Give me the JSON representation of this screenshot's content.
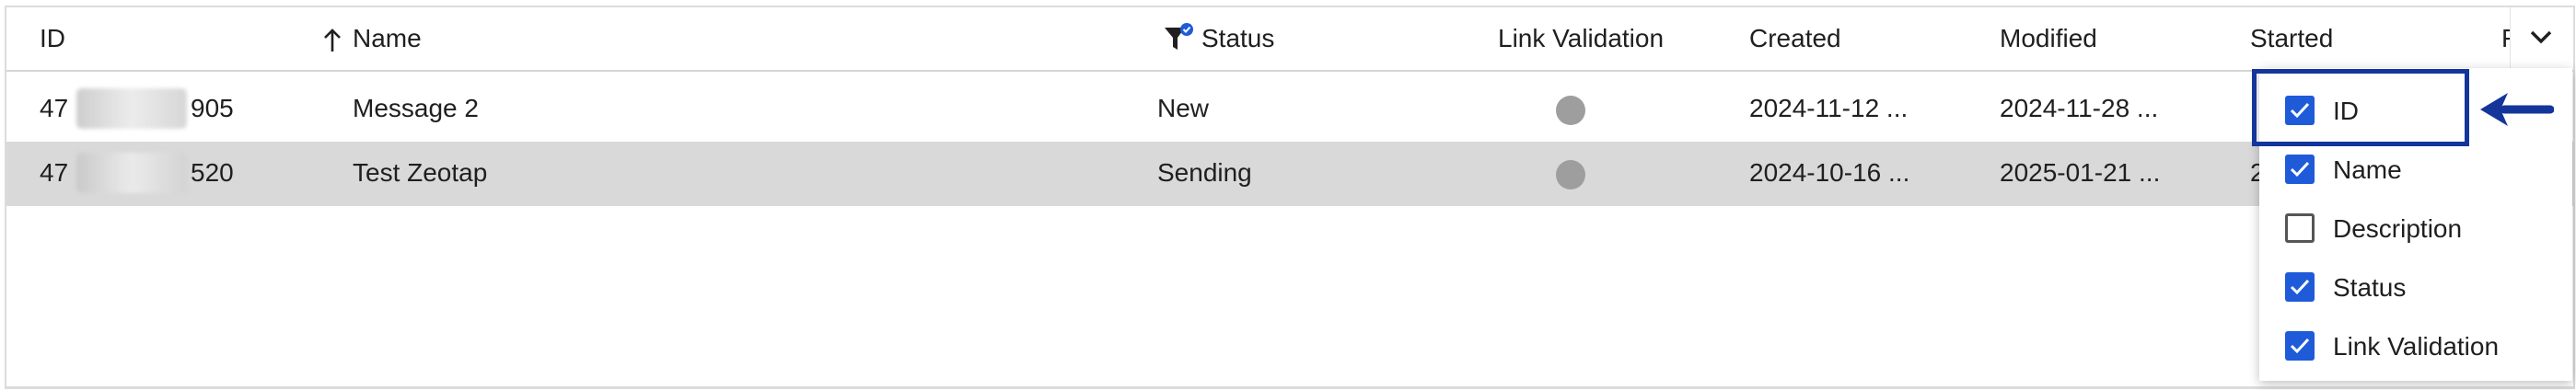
{
  "columns": {
    "id": "ID",
    "name": "Name",
    "status": "Status",
    "link_validation": "Link Validation",
    "created": "Created",
    "modified": "Modified",
    "started": "Started",
    "partial": "F"
  },
  "rows": [
    {
      "id_prefix": "47",
      "id_suffix": "905",
      "name": "Message 2",
      "status": "New",
      "created": "2024-11-12 ...",
      "modified": "2024-11-28 ...",
      "started": ""
    },
    {
      "id_prefix": "47",
      "id_suffix": "520",
      "name": "Test Zeotap",
      "status": "Sending",
      "created": "2024-10-16 ...",
      "modified": "2025-01-21 ...",
      "started": "2"
    }
  ],
  "column_menu": {
    "options": [
      {
        "label": "ID",
        "checked": true
      },
      {
        "label": "Name",
        "checked": true
      },
      {
        "label": "Description",
        "checked": false
      },
      {
        "label": "Status",
        "checked": true
      },
      {
        "label": "Link Validation",
        "checked": true
      }
    ]
  },
  "colors": {
    "accent": "#1f5bd9",
    "highlight": "#14359a",
    "selected_row": "#d9d9d9",
    "dot": "#9e9e9e"
  },
  "icons": {
    "sort": "arrow-up-icon",
    "filter": "filter-active-icon",
    "menu": "chevron-down-icon",
    "pointer": "arrow-left-icon"
  }
}
